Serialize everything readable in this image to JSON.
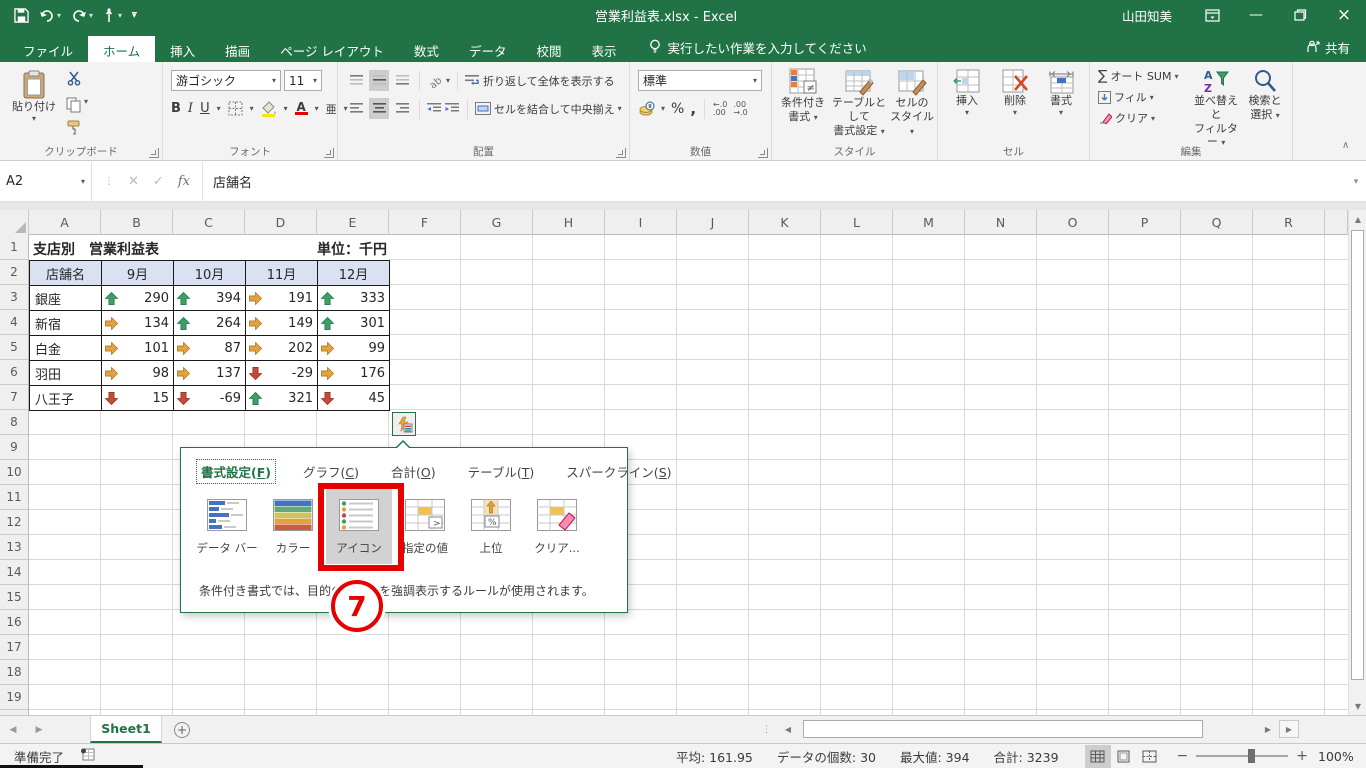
{
  "titlebar": {
    "title": "営業利益表.xlsx  -  Excel",
    "user": "山田知美",
    "qat_icons": [
      "save-icon",
      "undo-icon",
      "redo-icon",
      "touch-mode-icon",
      "customize-qat-icon"
    ],
    "window_icons": [
      "ribbon-display-options-icon",
      "minimize-icon",
      "restore-icon",
      "close-icon"
    ]
  },
  "ribbon": {
    "tabs": [
      "ファイル",
      "ホーム",
      "挿入",
      "描画",
      "ページ レイアウト",
      "数式",
      "データ",
      "校閲",
      "表示"
    ],
    "active_tab": "ホーム",
    "tell_me": "実行したい作業を入力してください",
    "share": "共有",
    "groups": {
      "clipboard": {
        "label": "クリップボード",
        "paste": "貼り付け"
      },
      "font": {
        "label": "フォント",
        "name": "游ゴシック",
        "size": "11"
      },
      "alignment": {
        "label": "配置",
        "wrap": "折り返して全体を表示する",
        "merge": "セルを結合して中央揃え"
      },
      "number": {
        "label": "数値",
        "format": "標準"
      },
      "styles": {
        "label": "スタイル",
        "conditional_1": "条件付き",
        "conditional_2": "書式",
        "table_1": "テーブルとして",
        "table_2": "書式設定",
        "cell_1": "セルの",
        "cell_2": "スタイル"
      },
      "cells": {
        "label": "セル",
        "insert": "挿入",
        "delete": "削除",
        "format": "書式"
      },
      "editing": {
        "label": "編集",
        "autosum": "オート SUM",
        "fill": "フィル",
        "clear": "クリア",
        "sort_1": "並べ替えと",
        "sort_2": "フィルター",
        "find_1": "検索と",
        "find_2": "選択"
      }
    }
  },
  "formula_bar": {
    "name_box": "A2",
    "value": "店舗名"
  },
  "sheet": {
    "columns": [
      "A",
      "B",
      "C",
      "D",
      "E",
      "F",
      "G",
      "H",
      "I",
      "J",
      "K",
      "L",
      "M",
      "N",
      "O",
      "P",
      "Q",
      "R"
    ],
    "visible_rows": 19,
    "title": "支店別　営業利益表",
    "unit": "単位：千円",
    "table": {
      "headers": [
        "店舗名",
        "9月",
        "10月",
        "11月",
        "12月"
      ],
      "rows": [
        {
          "name": "銀座",
          "values": [
            {
              "icon": "up",
              "v": "290"
            },
            {
              "icon": "up",
              "v": "394"
            },
            {
              "icon": "right",
              "v": "191"
            },
            {
              "icon": "up",
              "v": "333"
            }
          ]
        },
        {
          "name": "新宿",
          "values": [
            {
              "icon": "right",
              "v": "134"
            },
            {
              "icon": "up",
              "v": "264"
            },
            {
              "icon": "right",
              "v": "149"
            },
            {
              "icon": "up",
              "v": "301"
            }
          ]
        },
        {
          "name": "白金",
          "values": [
            {
              "icon": "right",
              "v": "101"
            },
            {
              "icon": "right",
              "v": "87"
            },
            {
              "icon": "right",
              "v": "202"
            },
            {
              "icon": "right",
              "v": "99"
            }
          ]
        },
        {
          "name": "羽田",
          "values": [
            {
              "icon": "right",
              "v": "98"
            },
            {
              "icon": "right",
              "v": "137"
            },
            {
              "icon": "down",
              "v": "-29"
            },
            {
              "icon": "right",
              "v": "176"
            }
          ]
        },
        {
          "name": "八王子",
          "values": [
            {
              "icon": "down",
              "v": "15"
            },
            {
              "icon": "down",
              "v": "-69"
            },
            {
              "icon": "up",
              "v": "321"
            },
            {
              "icon": "down",
              "v": "45"
            }
          ]
        }
      ]
    },
    "sheet_tab": "Sheet1"
  },
  "quick_analysis": {
    "tabs": [
      {
        "label": "書式設定(F)",
        "active": true
      },
      {
        "label": "グラフ(C)",
        "active": false
      },
      {
        "label": "合計(O)",
        "active": false
      },
      {
        "label": "テーブル(T)",
        "active": false
      },
      {
        "label": "スパークライン(S)",
        "active": false
      }
    ],
    "items": [
      {
        "label": "データ バー",
        "icon": "data-bars",
        "highlighted": false
      },
      {
        "label": "カラー",
        "icon": "color-scale",
        "highlighted": false
      },
      {
        "label": "アイコン",
        "icon": "icon-set",
        "highlighted": true
      },
      {
        "label": "指定の値",
        "icon": "greater-than",
        "highlighted": false
      },
      {
        "label": "上位",
        "icon": "top-ten-percent",
        "highlighted": false
      },
      {
        "label": "クリア...",
        "icon": "clear-format",
        "highlighted": false
      }
    ],
    "description": "条件付き書式では、目的のデータを強調表示するルールが使用されます。",
    "annotation_step": "7"
  },
  "status_bar": {
    "mode": "準備完了",
    "stats": [
      [
        "平均",
        "161.95"
      ],
      [
        "データの個数",
        "30"
      ],
      [
        "最大値",
        "394"
      ],
      [
        "合計",
        "3239"
      ]
    ],
    "zoom_level": "100%"
  },
  "colors": {
    "accent_green": "#217346",
    "arrow_up": "#3E9E68",
    "arrow_right": "#E3A23F",
    "arrow_down": "#C64A3A",
    "annotation_red": "#E60000",
    "table_header_bg": "#D9E1F2"
  }
}
